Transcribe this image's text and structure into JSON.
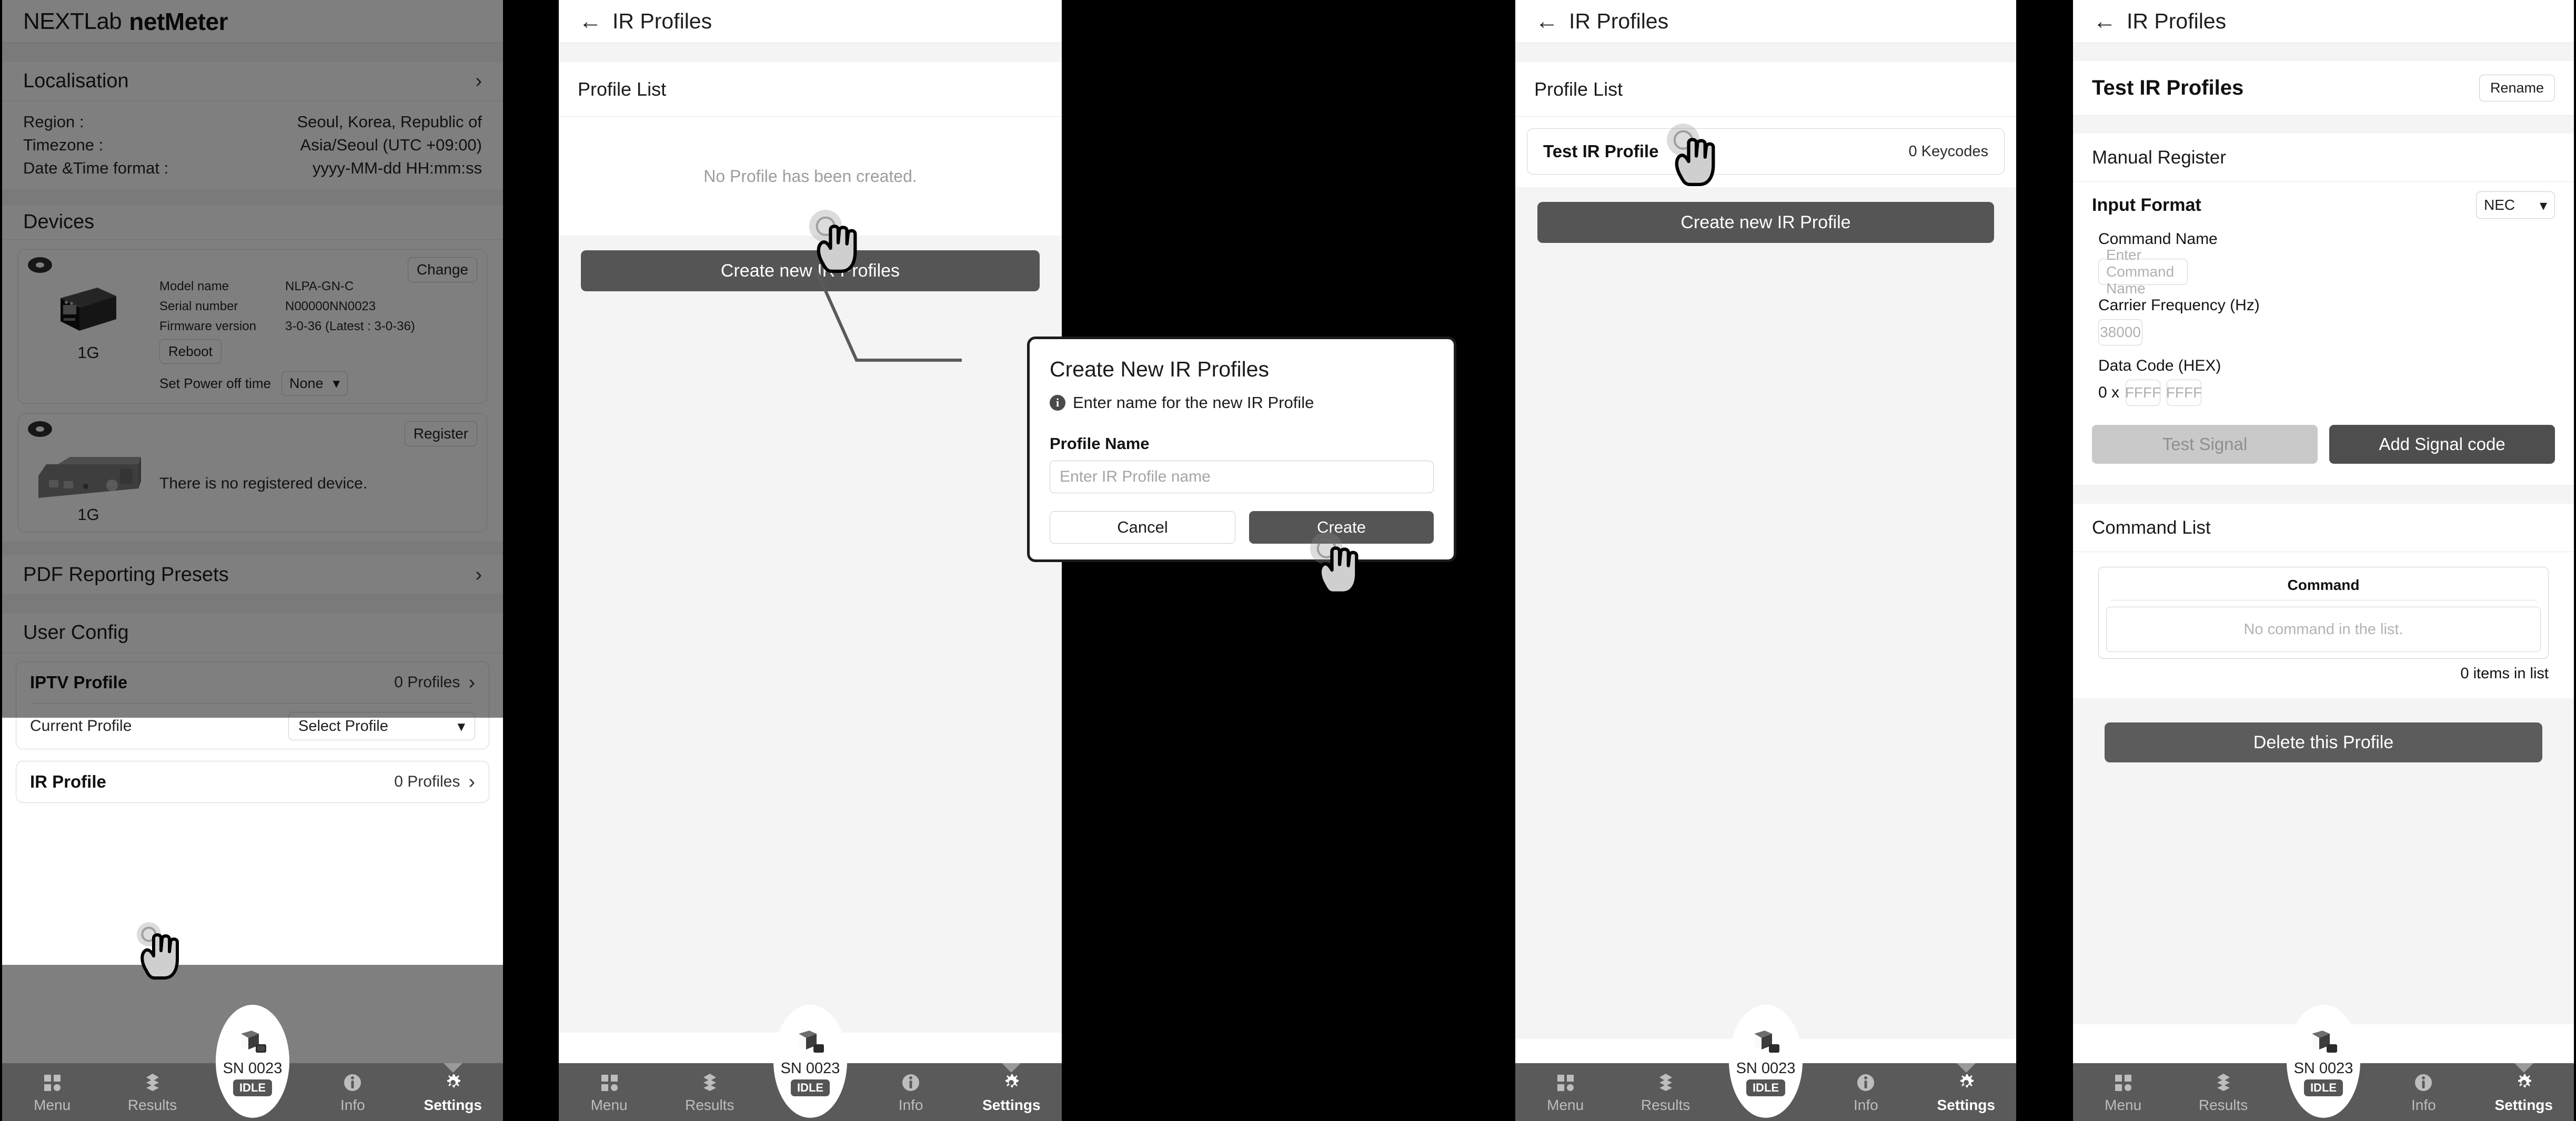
{
  "panel1": {
    "brand": {
      "light": "NEXTLab",
      "bold": "netMeter"
    },
    "sections": [
      {
        "title": "Localisation",
        "chevron": "›"
      },
      {
        "title": "Devices"
      },
      {
        "title": "PDF Reporting Presets",
        "chevron": "›"
      },
      {
        "title": "User Config"
      }
    ],
    "localisation_rows": [
      {
        "key": "Region :",
        "value": "Seoul, Korea, Republic of"
      },
      {
        "key": "Timezone :",
        "value": "Asia/Seoul (UTC +09:00)"
      },
      {
        "key": "Date &Time format :",
        "value": "yyyy-MM-dd HH:mm:ss"
      }
    ],
    "device1": {
      "change_label": "Change",
      "caption": "1G",
      "fields": [
        {
          "label": "Model name",
          "value": "NLPA-GN-C"
        },
        {
          "label": "Serial number",
          "value": "N00000NN0023"
        },
        {
          "label": "Firmware version",
          "value": "3-0-36 (Latest : 3-0-36)"
        }
      ],
      "reboot_label": "Reboot",
      "poweroff_label": "Set Power off time",
      "poweroff_value": "None"
    },
    "device2": {
      "register_label": "Register",
      "caption": "1G",
      "message": "There is no registered device."
    },
    "user_config": {
      "iptv": {
        "name": "IPTV Profile",
        "count": "0 Profiles",
        "chevron": "›"
      },
      "current_profile_label": "Current Profile",
      "current_profile_value": "Select Profile",
      "ir": {
        "name": "IR Profile",
        "count": "0 Profiles",
        "chevron": "›"
      }
    }
  },
  "panel2": {
    "topbar_title": "IR Profiles",
    "back_icon": "←",
    "profile_list_title": "Profile List",
    "empty_text": "No Profile has been created.",
    "create_button": "Create new IR Profiles"
  },
  "modal": {
    "title": "Create New IR Profiles",
    "info_text": "Enter name for the new IR Profile",
    "info_glyph": "i",
    "field_label": "Profile Name",
    "input_placeholder": "Enter IR Profile name",
    "cancel_label": "Cancel",
    "create_label": "Create"
  },
  "panel3": {
    "topbar_title": "IR Profiles",
    "back_icon": "←",
    "profile_list_title": "Profile List",
    "profile_name": "Test IR Profile",
    "profile_count": "0 Keycodes",
    "create_button": "Create new IR Profile"
  },
  "panel4": {
    "topbar_title": "IR Profiles",
    "back_icon": "←",
    "page_title": "Test IR Profiles",
    "rename_label": "Rename",
    "manual_register_title": "Manual Register",
    "input_format_label": "Input Format",
    "input_format_value": "NEC",
    "command_name_label": "Command Name",
    "command_name_placeholder": "Enter Command Name",
    "carrier_label": "Carrier Frequency (Hz)",
    "carrier_placeholder": "38000",
    "datacode_label": "Data Code (HEX)",
    "hex_prefix": "0 x",
    "hex1_placeholder": "FFFF",
    "hex2_placeholder": "FFFF",
    "test_signal_label": "Test Signal",
    "add_signal_label": "Add Signal code",
    "command_list_title": "Command List",
    "command_column": "Command",
    "command_empty": "No command in the list.",
    "items_in_list": "0 items in list",
    "delete_label": "Delete this Profile"
  },
  "bottomnav": {
    "items": [
      {
        "label": "Menu",
        "icon": "grid-icon"
      },
      {
        "label": "Results",
        "icon": "stack-icon"
      },
      {
        "label": "Info",
        "icon": "info-icon"
      },
      {
        "label": "Settings",
        "icon": "gear-icon"
      }
    ],
    "device_sn": "SN 0023",
    "device_status": "IDLE"
  },
  "colors": {
    "accent_dark": "#555555",
    "nav_bg": "#5a5a5a",
    "panel_bg": "#ffffff",
    "section_bg": "#f4f4f4",
    "muted_text": "#9d9d9d",
    "disabled_bg": "#c9c9c9"
  }
}
